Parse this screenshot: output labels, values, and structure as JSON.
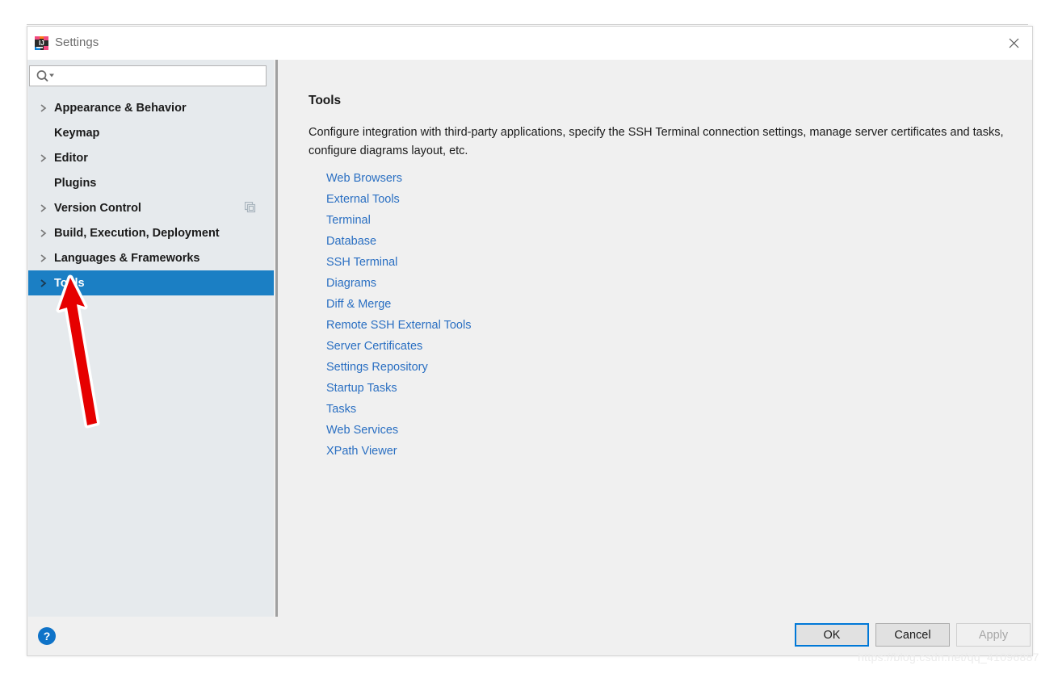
{
  "window": {
    "title": "Settings",
    "logo_icon": "intellij-idea-logo",
    "close_icon": "close-icon"
  },
  "search": {
    "value": "",
    "placeholder": "",
    "icon": "search-icon",
    "dropdown_icon": "chevron-down-icon"
  },
  "sidebar": {
    "items": [
      {
        "label": "Appearance & Behavior",
        "expandable": true,
        "selected": false,
        "icon": null
      },
      {
        "label": "Keymap",
        "expandable": false,
        "selected": false,
        "icon": null
      },
      {
        "label": "Editor",
        "expandable": true,
        "selected": false,
        "icon": null
      },
      {
        "label": "Plugins",
        "expandable": false,
        "selected": false,
        "icon": null
      },
      {
        "label": "Version Control",
        "expandable": true,
        "selected": false,
        "icon": "copy-icon"
      },
      {
        "label": "Build, Execution, Deployment",
        "expandable": true,
        "selected": false,
        "icon": null
      },
      {
        "label": "Languages & Frameworks",
        "expandable": true,
        "selected": false,
        "icon": null
      },
      {
        "label": "Tools",
        "expandable": true,
        "selected": true,
        "icon": null
      }
    ]
  },
  "main": {
    "title": "Tools",
    "description": "Configure integration with third-party applications, specify the SSH Terminal connection settings, manage server certificates and tasks, configure diagrams layout, etc.",
    "links": [
      "Web Browsers",
      "External Tools",
      "Terminal",
      "Database",
      "SSH Terminal",
      "Diagrams",
      "Diff & Merge",
      "Remote SSH External Tools",
      "Server Certificates",
      "Settings Repository",
      "Startup Tasks",
      "Tasks",
      "Web Services",
      "XPath Viewer"
    ]
  },
  "footer": {
    "help_icon": "help-icon",
    "ok_label": "OK",
    "cancel_label": "Cancel",
    "apply_label": "Apply",
    "apply_disabled": true
  },
  "annotation": {
    "arrow_color": "#e60000",
    "arrow_outline": "#ffffff",
    "points_at": "Tools"
  },
  "watermark": "https://blog.csdn.net/qq_41096887",
  "colors": {
    "selection_blue": "#1b7fc4",
    "link_blue": "#2a6fc2",
    "sidebar_bg": "#e6eaed",
    "panel_bg": "#f0f0f0",
    "focus_blue": "#0078d7"
  }
}
